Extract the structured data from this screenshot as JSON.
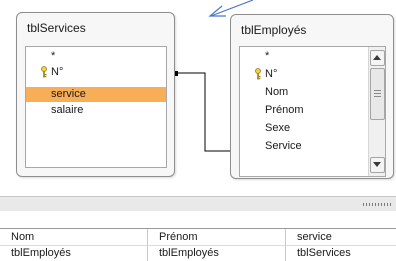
{
  "tables": [
    {
      "title": "tblServices",
      "fields": [
        {
          "label": "*",
          "key": false,
          "selected": false
        },
        {
          "label": "N°",
          "key": true,
          "selected": false
        },
        {
          "label": "service",
          "key": false,
          "selected": true
        },
        {
          "label": "salaire",
          "key": false,
          "selected": false
        }
      ]
    },
    {
      "title": "tblEmployés",
      "fields": [
        {
          "label": "*",
          "key": false,
          "selected": false
        },
        {
          "label": "N°",
          "key": true,
          "selected": false
        },
        {
          "label": "Nom",
          "key": false,
          "selected": false
        },
        {
          "label": "Prénom",
          "key": false,
          "selected": false
        },
        {
          "label": "Sexe",
          "key": false,
          "selected": false
        },
        {
          "label": "Service",
          "key": false,
          "selected": false
        }
      ]
    }
  ],
  "grid": {
    "columns": [
      {
        "field": "Nom",
        "table": "tblEmployés"
      },
      {
        "field": "Prénom",
        "table": "tblEmployés"
      },
      {
        "field": "service",
        "table": "tblServices"
      }
    ]
  },
  "icons": {
    "primary_key": "key-icon",
    "scroll_up": "scroll-up-arrow-icon",
    "scroll_down": "scroll-down-arrow-icon",
    "annotation_arrow": "annotation-arrow-icon"
  },
  "colors": {
    "selected_field": "#f7ae56",
    "annotation_arrow": "#4a78c4"
  }
}
